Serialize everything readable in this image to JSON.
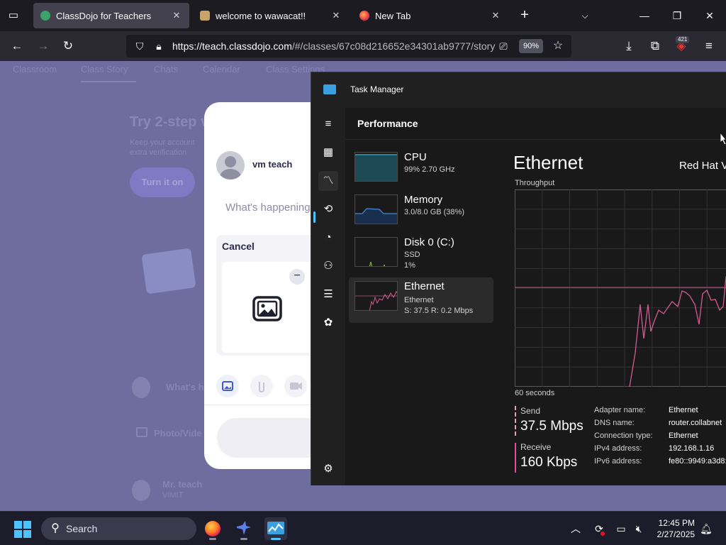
{
  "browser": {
    "tabs": [
      {
        "title": "ClassDojo for Teachers",
        "active": true
      },
      {
        "title": "welcome to wawacat!!",
        "active": false
      },
      {
        "title": "New Tab",
        "active": false
      }
    ],
    "url_host": "https://teach.classdojo.com",
    "url_path": "/#/classes/67c08d216652e34301ab9777/story",
    "zoom": "90%",
    "extension_badge": "421"
  },
  "webpage": {
    "nav_tabs": [
      "Classroom",
      "Class Story",
      "Chats",
      "Calendar",
      "Class Settings"
    ],
    "heading": "Try 2-step v",
    "subtext_line1": "Keep your account",
    "subtext_line2": "extra verification",
    "cta_button": "Turn it on",
    "feed_placeholder": "What's h",
    "photo_video_label": "Photo/Vide",
    "author_name": "Mr. teach",
    "author_role": "VIMIT"
  },
  "modal": {
    "user_name": "vm teach",
    "placeholder": "What's happening",
    "cancel_label": "Cancel",
    "minus_label": "−"
  },
  "task_manager": {
    "title": "Task Manager",
    "section_title": "Performance",
    "resources": [
      {
        "name": "CPU",
        "line1": "99%  2.70 GHz",
        "line2": "",
        "line3": ""
      },
      {
        "name": "Memory",
        "line1": "3.0/8.0 GB (38%)",
        "line2": "",
        "line3": ""
      },
      {
        "name": "Disk 0 (C:)",
        "line1": "SSD",
        "line2": "1%",
        "line3": ""
      },
      {
        "name": "Ethernet",
        "line1": "Ethernet",
        "line2": "S: 37.5  R: 0.2 Mbps",
        "line3": ""
      }
    ],
    "detail": {
      "title": "Ethernet",
      "adapter": "Red Hat V",
      "throughput_label": "Throughput",
      "time_label": "60 seconds",
      "send_label": "Send",
      "send_value": "37.5 Mbps",
      "receive_label": "Receive",
      "receive_value": "160 Kbps",
      "info": [
        {
          "key": "Adapter name:",
          "value": "Ethernet"
        },
        {
          "key": "DNS name:",
          "value": "router.collabnet"
        },
        {
          "key": "Connection type:",
          "value": "Ethernet"
        },
        {
          "key": "IPv4 address:",
          "value": "192.168.1.16"
        },
        {
          "key": "IPv6 address:",
          "value": "fe80::9949:a3d8:"
        }
      ]
    },
    "colors": {
      "send": "#e8a0b8",
      "receive": "#e05090",
      "accent": "#4cc2ff"
    }
  },
  "taskbar": {
    "search_label": "Search",
    "time": "12:45 PM",
    "date": "2/27/2025"
  }
}
